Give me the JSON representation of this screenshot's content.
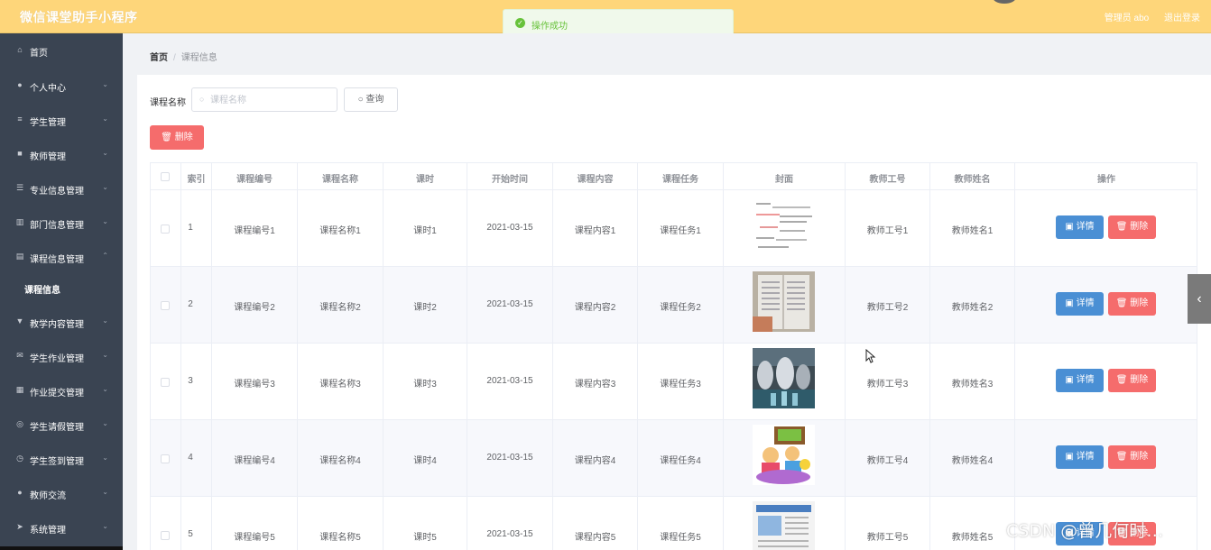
{
  "header": {
    "app_title": "微信课堂助手小程序",
    "user": "管理员 abo",
    "logout": "退出登录"
  },
  "toast": {
    "message": "操作成功"
  },
  "sidebar": {
    "items": [
      {
        "label": "首页",
        "icon": "home-icon",
        "has_arrow": false
      },
      {
        "label": "个人中心",
        "icon": "user-icon",
        "has_arrow": true
      },
      {
        "label": "学生管理",
        "icon": "list-icon",
        "has_arrow": true
      },
      {
        "label": "教师管理",
        "icon": "briefcase-icon",
        "has_arrow": true
      },
      {
        "label": "专业信息管理",
        "icon": "sliders-icon",
        "has_arrow": true
      },
      {
        "label": "部门信息管理",
        "icon": "building-icon",
        "has_arrow": true
      },
      {
        "label": "课程信息管理",
        "icon": "document-icon",
        "has_arrow": true,
        "expanded": true
      },
      {
        "label": "教学内容管理",
        "icon": "chat-icon",
        "has_arrow": true
      },
      {
        "label": "学生作业管理",
        "icon": "mail-icon",
        "has_arrow": true
      },
      {
        "label": "作业提交管理",
        "icon": "grid-icon",
        "has_arrow": true
      },
      {
        "label": "学生请假管理",
        "icon": "compass-icon",
        "has_arrow": true
      },
      {
        "label": "学生签到管理",
        "icon": "clock-icon",
        "has_arrow": true
      },
      {
        "label": "教师交流",
        "icon": "user-icon",
        "has_arrow": true
      },
      {
        "label": "系统管理",
        "icon": "send-icon",
        "has_arrow": true
      }
    ],
    "sub_item": "课程信息"
  },
  "breadcrumb": {
    "home": "首页",
    "separator": "/",
    "current": "课程信息"
  },
  "search": {
    "label": "课程名称",
    "placeholder": "课程名称",
    "button": "查询"
  },
  "toolbar": {
    "delete": "删除"
  },
  "table": {
    "columns": [
      "索引",
      "课程编号",
      "课程名称",
      "课时",
      "开始时间",
      "课程内容",
      "课程任务",
      "封面",
      "教师工号",
      "教师姓名",
      "操作"
    ],
    "rows": [
      {
        "index": "1",
        "code": "课程编号1",
        "name": "课程名称1",
        "hours": "课时1",
        "start": "2021-03-15",
        "content": "课程内容1",
        "task": "课程任务1",
        "teacher_id": "教师工号1",
        "teacher_name": "教师姓名1"
      },
      {
        "index": "2",
        "code": "课程编号2",
        "name": "课程名称2",
        "hours": "课时2",
        "start": "2021-03-15",
        "content": "课程内容2",
        "task": "课程任务2",
        "teacher_id": "教师工号2",
        "teacher_name": "教师姓名2"
      },
      {
        "index": "3",
        "code": "课程编号3",
        "name": "课程名称3",
        "hours": "课时3",
        "start": "2021-03-15",
        "content": "课程内容3",
        "task": "课程任务3",
        "teacher_id": "教师工号3",
        "teacher_name": "教师姓名3"
      },
      {
        "index": "4",
        "code": "课程编号4",
        "name": "课程名称4",
        "hours": "课时4",
        "start": "2021-03-15",
        "content": "课程内容4",
        "task": "课程任务4",
        "teacher_id": "教师工号4",
        "teacher_name": "教师姓名4"
      },
      {
        "index": "5",
        "code": "课程编号5",
        "name": "课程名称5",
        "hours": "课时5",
        "start": "2021-03-15",
        "content": "课程内容5",
        "task": "课程任务5",
        "teacher_id": "教师工号5",
        "teacher_name": "教师姓名5"
      }
    ],
    "detail_label": "详情",
    "delete_label": "删除"
  },
  "watermark": "CSDN @曾几何时…",
  "colors": {
    "header": "#fed67a",
    "sidebar": "#3a4452",
    "primary": "#4a8fd4",
    "danger": "#f56c6c",
    "success": "#67c23a"
  }
}
